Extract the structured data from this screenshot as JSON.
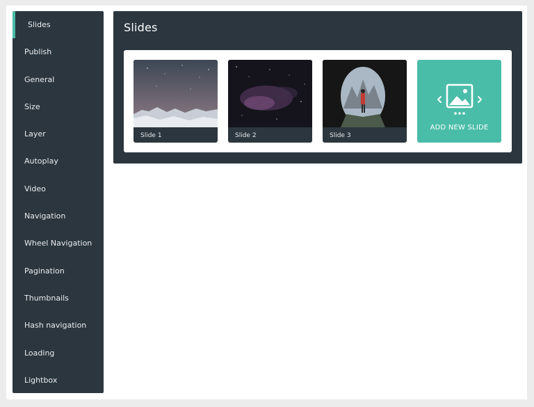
{
  "sidebar": {
    "items": [
      {
        "label": "Slides",
        "active": true
      },
      {
        "label": "Publish"
      },
      {
        "label": "General"
      },
      {
        "label": "Size"
      },
      {
        "label": "Layer"
      },
      {
        "label": "Autoplay"
      },
      {
        "label": "Video"
      },
      {
        "label": "Navigation"
      },
      {
        "label": "Wheel Navigation"
      },
      {
        "label": "Pagination"
      },
      {
        "label": "Thumbnails"
      },
      {
        "label": "Hash navigation"
      },
      {
        "label": "Loading"
      },
      {
        "label": "Lightbox"
      }
    ]
  },
  "panel": {
    "title": "Slides",
    "slides": [
      {
        "label": "Slide 1",
        "image": "snowy-mountains-starry-sky"
      },
      {
        "label": "Slide 2",
        "image": "purple-nebula-stars"
      },
      {
        "label": "Slide 3",
        "image": "cave-hiker-mountain-view"
      }
    ],
    "add_slide_label": "ADD NEW SLIDE"
  },
  "colors": {
    "sidebar_bg": "#2c363e",
    "accent": "#49bba7",
    "add_slide_bg": "#4abda9"
  }
}
